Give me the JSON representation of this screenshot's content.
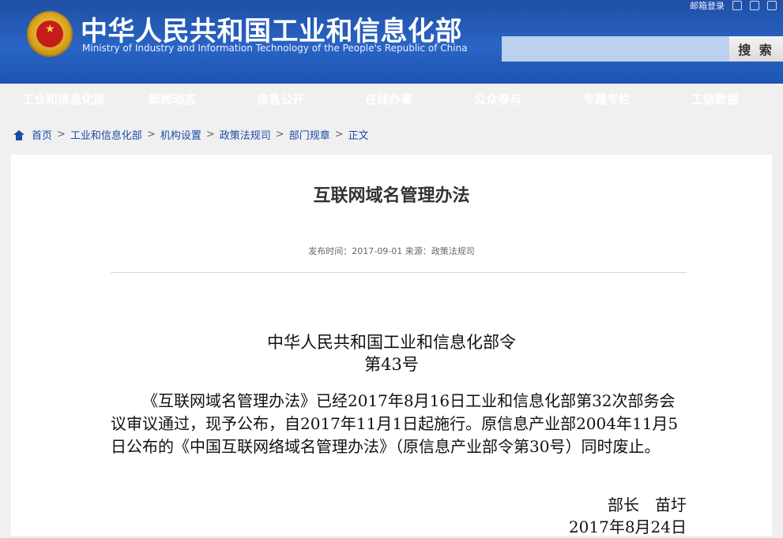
{
  "header": {
    "title_cn": "中华人民共和国工业和信息化部",
    "title_en": "Ministry of Industry and Information Technology of the People's Republic of China",
    "top_links": [
      "邮箱登录"
    ],
    "search": {
      "placeholder": "",
      "button_label": "搜 索"
    }
  },
  "nav": {
    "items": [
      "工业和信息化部",
      "新闻动态",
      "信息公开",
      "在线办事",
      "公众参与",
      "专题专栏",
      "工信数据"
    ]
  },
  "breadcrumb": {
    "items": [
      "首页",
      "工业和信息化部",
      "机构设置",
      "政策法规司",
      "部门规章",
      "正文"
    ],
    "separator": ">"
  },
  "article": {
    "title": "互联网域名管理办法",
    "meta": "发布时间：2017-09-01   来源：政策法规司",
    "decree_title": "中华人民共和国工业和信息化部令",
    "decree_no": "第43号",
    "body": "《互联网域名管理办法》已经2017年8月16日工业和信息化部第32次部务会议审议通过，现予公布，自2017年11月1日起施行。原信息产业部2004年11月5日公布的《中国互联网络域名管理办法》（原信息产业部令第30号）同时废止。",
    "signature_line1": "部长　苗圩",
    "signature_line2": "2017年8月24日"
  },
  "colors": {
    "header_blue": "#1f4fa6",
    "link_blue": "#1b4aa5",
    "page_bg": "#f0f0f0"
  },
  "icons": {
    "home": "home-icon",
    "emblem": "national-emblem-icon"
  }
}
